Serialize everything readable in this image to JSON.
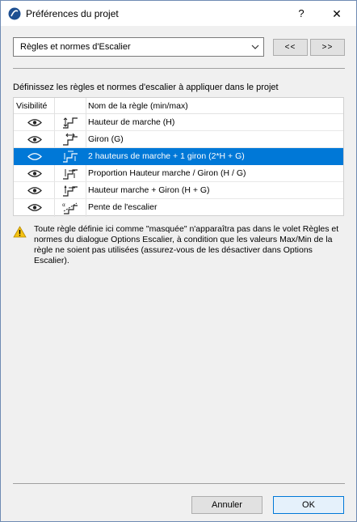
{
  "window": {
    "title": "Préférences du projet",
    "help_label": "?",
    "close_label": "✕"
  },
  "selector": {
    "value": "Règles et normes d'Escalier",
    "prev_label": "<<",
    "next_label": ">>"
  },
  "instruction": "Définissez les règles et normes d'escalier à appliquer dans le projet",
  "table": {
    "headers": {
      "visibility": "Visibilité",
      "name": "Nom de la règle (min/max)"
    },
    "rows": [
      {
        "name": "Hauteur de marche (H)",
        "visible": true,
        "selected": false,
        "icon": "riser-height-icon"
      },
      {
        "name": "Giron (G)",
        "visible": true,
        "selected": false,
        "icon": "going-icon"
      },
      {
        "name": "2 hauteurs de marche + 1 giron (2*H + G)",
        "visible": true,
        "selected": true,
        "icon": "two-risers-going-icon"
      },
      {
        "name": "Proportion Hauteur marche / Giron (H / G)",
        "visible": true,
        "selected": false,
        "icon": "riser-going-ratio-icon"
      },
      {
        "name": "Hauteur marche + Giron (H + G)",
        "visible": true,
        "selected": false,
        "icon": "riser-plus-going-icon"
      },
      {
        "name": "Pente de l'escalier",
        "visible": true,
        "selected": false,
        "icon": "stair-slope-icon"
      }
    ]
  },
  "warning": {
    "icon": "warning-icon",
    "text": "Toute règle définie ici comme \"masquée\" n'apparaîtra pas dans le volet Règles et normes du dialogue Options Escalier, à condition que les valeurs Max/Min de la règle ne soient pas utilisées (assurez-vous de les désactiver dans Options Escalier)."
  },
  "buttons": {
    "cancel": "Annuler",
    "ok": "OK"
  },
  "colors": {
    "selection": "#0078d7",
    "warning": "#f5c211",
    "dialog_bg": "#f0f0f0"
  }
}
